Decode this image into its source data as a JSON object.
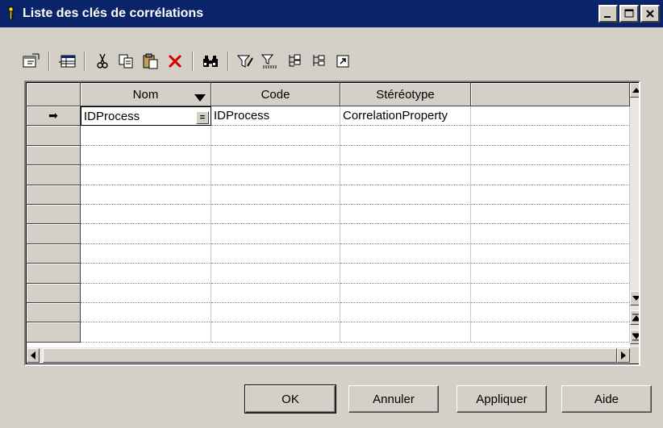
{
  "window": {
    "title": "Liste des clés de corrélations",
    "controls": [
      "minimize",
      "maximize",
      "close"
    ]
  },
  "toolbar": {
    "buttons": [
      {
        "name": "properties-icon"
      },
      {
        "name": "insert-row-icon"
      },
      {
        "name": "cut-icon"
      },
      {
        "name": "copy-icon"
      },
      {
        "name": "paste-icon"
      },
      {
        "name": "delete-icon"
      },
      {
        "name": "find-icon"
      },
      {
        "name": "filter-icon"
      },
      {
        "name": "filter-list-icon"
      },
      {
        "name": "move-up-icon"
      },
      {
        "name": "move-down-icon"
      },
      {
        "name": "customize-icon"
      }
    ]
  },
  "grid": {
    "columns": [
      "Nom",
      "Code",
      "Stéréotype",
      ""
    ],
    "sort_column": "Nom",
    "rows": [
      {
        "nom": "IDProcess",
        "code": "IDProcess",
        "stereotype": "CorrelationProperty",
        "current": true
      }
    ],
    "empty_row_count": 11,
    "current_row_marker": "➡",
    "cell_button_label": "="
  },
  "buttons": {
    "ok": "OK",
    "cancel": "Annuler",
    "apply": "Appliquer",
    "help": "Aide"
  },
  "colors": {
    "titlebar": "#0a246a",
    "dialog": "#d4d0c8",
    "delete_icon": "#d40000"
  }
}
